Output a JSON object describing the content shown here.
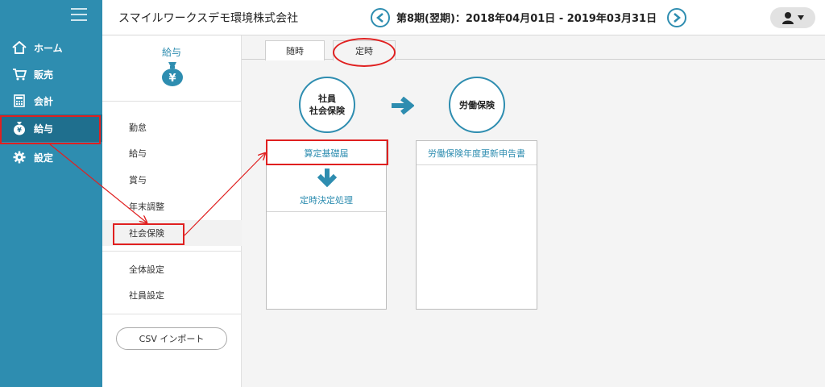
{
  "nav": {
    "items": [
      {
        "label": "ホーム",
        "icon": "home-icon"
      },
      {
        "label": "販売",
        "icon": "cart-icon"
      },
      {
        "label": "会計",
        "icon": "calculator-icon"
      },
      {
        "label": "給与",
        "icon": "money-bag-icon",
        "active": true
      },
      {
        "label": "設定",
        "icon": "gear-icon"
      }
    ]
  },
  "header": {
    "company": "スマイルワークスデモ環境株式会社",
    "period": "第8期(翌期)：2018年04月01日 - 2019年03月31日"
  },
  "submenu": {
    "title": "給与",
    "items": [
      {
        "label": "勤怠"
      },
      {
        "label": "給与"
      },
      {
        "label": "賞与"
      },
      {
        "label": "年末調整"
      },
      {
        "label": "社会保険",
        "active": true
      }
    ],
    "settings": [
      {
        "label": "全体設定"
      },
      {
        "label": "社員設定"
      }
    ],
    "csv_button": "CSV インポート"
  },
  "main": {
    "tabs": [
      {
        "label": "随時"
      },
      {
        "label": "定時",
        "active": true
      }
    ],
    "employee_circle": {
      "line1": "社員",
      "line2": "社会保険"
    },
    "labor_circle": "労働保険",
    "employee_panel": {
      "santei": "算定基礎届",
      "teiji": "定時決定処理"
    },
    "labor_panel": {
      "item": "労働保険年度更新申告書"
    }
  },
  "colors": {
    "nav_bg": "#2e8db0",
    "accent": "#2e8db0",
    "highlight": "#e02020"
  }
}
